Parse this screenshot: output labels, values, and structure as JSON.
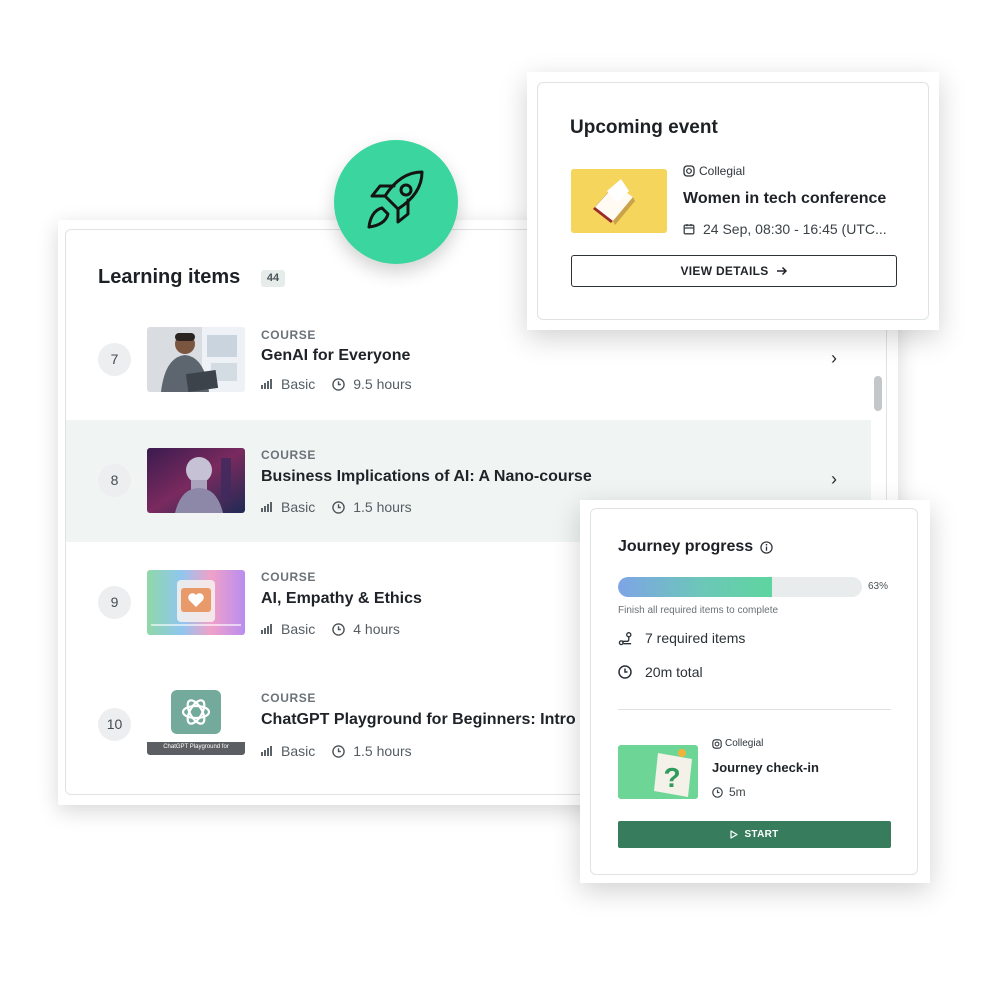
{
  "learning": {
    "title": "Learning items",
    "count": "44",
    "items": [
      {
        "number": "7",
        "kind": "COURSE",
        "title": "GenAI for Everyone",
        "level": "Basic",
        "duration": "9.5 hours"
      },
      {
        "number": "8",
        "kind": "COURSE",
        "title": "Business Implications of AI: A Nano-course",
        "level": "Basic",
        "duration": "1.5 hours"
      },
      {
        "number": "9",
        "kind": "COURSE",
        "title": "AI, Empathy & Ethics",
        "level": "Basic",
        "duration": "4 hours"
      },
      {
        "number": "10",
        "kind": "COURSE",
        "title": "ChatGPT Playground for Beginners: Intro",
        "level": "Basic",
        "duration": "1.5 hours",
        "thumb_caption": "ChatGPT Playground for"
      }
    ]
  },
  "event": {
    "title": "Upcoming event",
    "provider": "Collegial",
    "name": "Women in tech conference",
    "date": "24 Sep, 08:30 - 16:45 (UTC...",
    "button": "VIEW DETAILS"
  },
  "journey": {
    "title": "Journey progress",
    "progress_percent": 63,
    "progress_label": "63%",
    "note": "Finish all required items to complete",
    "required_items": "7 required items",
    "total_time": "20m total",
    "checkin": {
      "provider": "Collegial",
      "name": "Journey check-in",
      "duration": "5m",
      "button": "START"
    }
  },
  "colors": {
    "accent_green": "#3bd59f",
    "start_button": "#367c5d",
    "row_highlight": "#f0f5f3"
  }
}
